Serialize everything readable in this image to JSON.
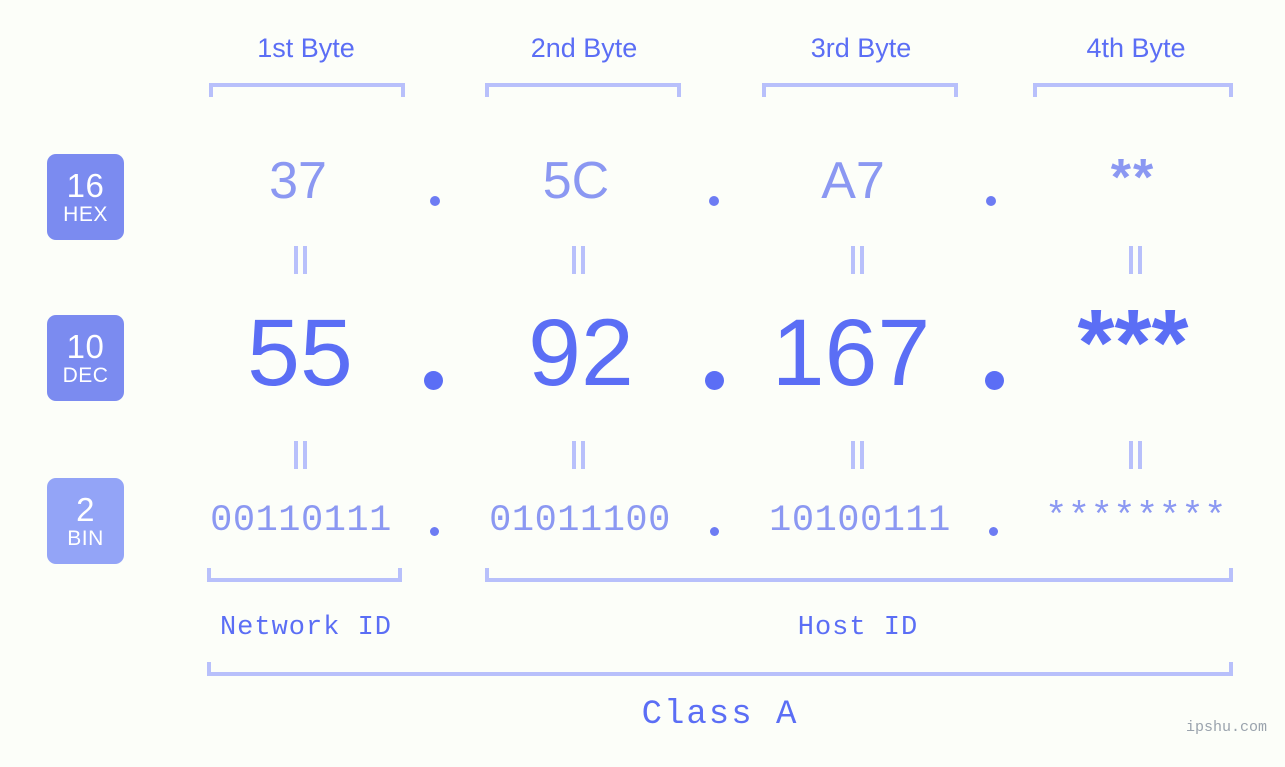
{
  "page": {
    "background_color": "#fcfef9",
    "accent_color": "#5b6ef5",
    "accent_light_color": "#8b98f2",
    "bracket_color": "#b8c0fb",
    "watermark": "ipshu.com"
  },
  "byte_headers": [
    {
      "label": "1st Byte"
    },
    {
      "label": "2nd Byte"
    },
    {
      "label": "3rd Byte"
    },
    {
      "label": "4th Byte"
    }
  ],
  "bases": [
    {
      "number": "16",
      "label": "HEX",
      "color": "#7b8bf0"
    },
    {
      "number": "10",
      "label": "DEC",
      "color": "#7b8bf0"
    },
    {
      "number": "2",
      "label": "BIN",
      "color": "#93a4f7"
    }
  ],
  "rows": {
    "hex": {
      "base_number": "16",
      "base_label": "HEX",
      "values": [
        "37",
        "5C",
        "A7",
        "**"
      ],
      "separator": "."
    },
    "dec": {
      "base_number": "10",
      "base_label": "DEC",
      "values": [
        "55",
        "92",
        "167",
        "***"
      ],
      "separator": "."
    },
    "bin": {
      "base_number": "2",
      "base_label": "BIN",
      "values": [
        "00110111",
        "01011100",
        "10100111",
        "********"
      ],
      "separator": "."
    }
  },
  "equality_marks": {
    "glyph": "||",
    "row1_count": 4,
    "row2_count": 4
  },
  "segments": {
    "network_id": "Network ID",
    "host_id": "Host ID",
    "class": "Class A"
  },
  "chart_data": {
    "type": "table",
    "title": "IP address byte breakdown",
    "columns": [
      "1st Byte",
      "2nd Byte",
      "3rd Byte",
      "4th Byte"
    ],
    "rows": [
      {
        "base": "16 HEX",
        "cells": [
          "37",
          "5C",
          "A7",
          "**"
        ]
      },
      {
        "base": "10 DEC",
        "cells": [
          "55",
          "92",
          "167",
          "***"
        ]
      },
      {
        "base": "2 BIN",
        "cells": [
          "00110111",
          "01011100",
          "10100111",
          "********"
        ]
      }
    ],
    "annotations": {
      "network_id_bytes": [
        "1st Byte"
      ],
      "host_id_bytes": [
        "2nd Byte",
        "3rd Byte",
        "4th Byte"
      ],
      "class": "Class A"
    }
  }
}
